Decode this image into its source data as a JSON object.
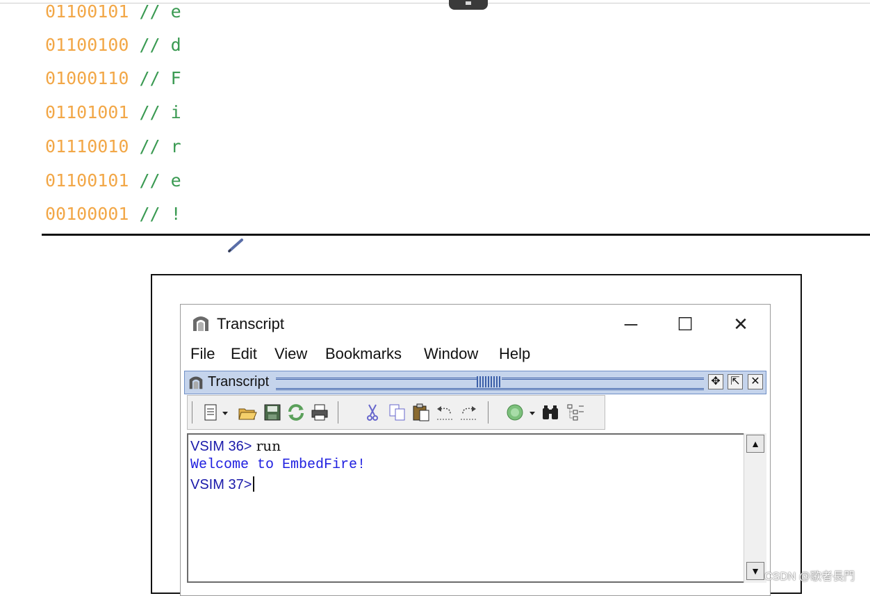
{
  "code_lines": [
    {
      "bits": "01100101",
      "comment": "// e"
    },
    {
      "bits": "01100100",
      "comment": "// d"
    },
    {
      "bits": "01000110",
      "comment": "// F"
    },
    {
      "bits": "01101001",
      "comment": "// i"
    },
    {
      "bits": "01110010",
      "comment": "// r"
    },
    {
      "bits": "01100101",
      "comment": "// e"
    },
    {
      "bits": "00100001",
      "comment": "// !"
    }
  ],
  "window": {
    "title": "Transcript",
    "controls": {
      "minimize": "─",
      "maximize": "☐",
      "close": "✕"
    },
    "menu": [
      "File",
      "Edit",
      "View",
      "Bookmarks",
      "Window",
      "Help"
    ]
  },
  "panel": {
    "title": "Transcript",
    "buttons": [
      "✥",
      "⇱",
      "✕"
    ]
  },
  "toolbar_icons": [
    "new-file-icon",
    "open-folder-icon",
    "save-icon",
    "refresh-icon",
    "print-icon",
    "cut-icon",
    "copy-icon",
    "paste-icon",
    "undo-icon",
    "redo-icon",
    "find-next-icon",
    "binoculars-icon",
    "tree-icon"
  ],
  "console": {
    "line1_prompt": "VSIM 36>",
    "line1_cmd": " run",
    "line2": "Welcome to EmbedFire!",
    "line3_prompt": "VSIM 37>"
  },
  "scroll": {
    "up": "▲",
    "down": "▼"
  },
  "watermark": "CSDN @歌者長門",
  "colors": {
    "bits": "#f2a747",
    "comment": "#3a9a52",
    "welcome": "#2020e0",
    "panel_bg": "#c5d4ec"
  }
}
